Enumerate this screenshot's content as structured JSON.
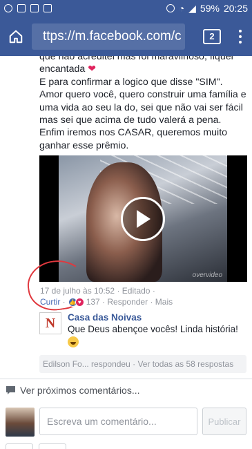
{
  "status_bar": {
    "battery": "59%",
    "time": "20:25"
  },
  "browser": {
    "url": "ttps://m.facebook.com/c",
    "tab_count": "2"
  },
  "post": {
    "text_lines": [
      "que não acreditei mas foi maravilhoso, fiquei",
      "encantada",
      "E para confirmar a logico que disse \"SIM\".",
      "Amor quero você, quero construir uma família e uma vida ao seu la do, sei que não vai ser fácil mas sei que acima de tudo valerá a pena.",
      "Enfim iremos nos CASAR, queremos muito ganhar esse prêmio."
    ],
    "heart_emoji": "❤",
    "video_watermark": "overvideo",
    "date": "17 de julho às 10:52",
    "edited": "Editado",
    "like_label": "Curtir",
    "reaction_count": "137",
    "reply_label": "Responder",
    "more_label": "Mais"
  },
  "reply": {
    "logo_letter": "N",
    "author": "Casa das Noivas",
    "text": "Que Deus abençoe vocês! Linda história!"
  },
  "more_replies": {
    "who": "Edilson Fo...",
    "action": "respondeu",
    "see_all": "Ver todas as 58 respostas"
  },
  "see_more_comments": "Ver próximos comentários...",
  "compose": {
    "placeholder": "Escreva um comentário...",
    "publish_label": "Publicar"
  },
  "colors": {
    "brand": "#3b5998",
    "link": "#385898",
    "annotation_circle": "#e0383e"
  }
}
